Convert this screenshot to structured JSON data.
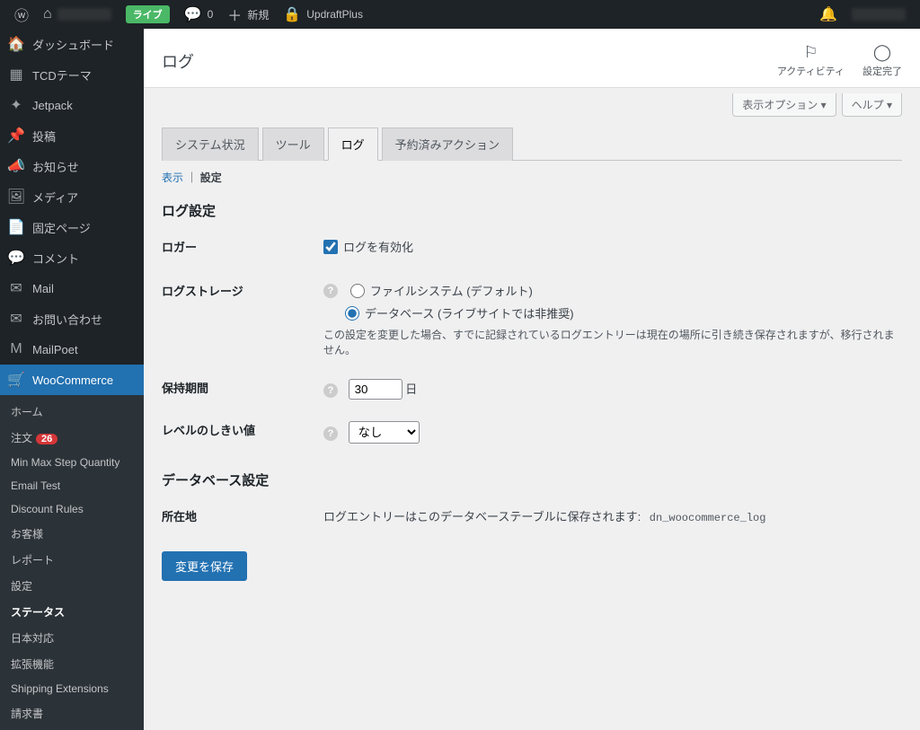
{
  "adminbar": {
    "live": "ライブ",
    "comments": "0",
    "add_new": "新規",
    "updraft": "UpdraftPlus"
  },
  "sidebar": {
    "items": [
      {
        "icon": "🏠",
        "label": "ダッシュボード"
      },
      {
        "icon": "▦",
        "label": "TCDテーマ"
      },
      {
        "icon": "✦",
        "label": "Jetpack"
      },
      {
        "icon": "📌",
        "label": "投稿"
      },
      {
        "icon": "📣",
        "label": "お知らせ"
      },
      {
        "icon": "🖼",
        "label": "メディア"
      },
      {
        "icon": "📄",
        "label": "固定ページ"
      },
      {
        "icon": "💬",
        "label": "コメント"
      },
      {
        "icon": "✉",
        "label": "Mail"
      },
      {
        "icon": "✉",
        "label": "お問い合わせ"
      },
      {
        "icon": "M",
        "label": "MailPoet"
      }
    ],
    "woocommerce": "WooCommerce",
    "submenu": [
      {
        "label": "ホーム"
      },
      {
        "label": "注文",
        "badge": "26"
      },
      {
        "label": "Min Max Step Quantity"
      },
      {
        "label": "Email Test"
      },
      {
        "label": "Discount Rules"
      },
      {
        "label": "お客様"
      },
      {
        "label": "レポート"
      },
      {
        "label": "設定"
      },
      {
        "label": "ステータス",
        "current": true
      },
      {
        "label": "日本対応"
      },
      {
        "label": "拡張機能"
      },
      {
        "label": "Shipping Extensions"
      },
      {
        "label": "請求書"
      }
    ]
  },
  "header": {
    "title": "ログ",
    "activity": "アクティビティ",
    "finish": "設定完了",
    "screen_options": "表示オプション ▾",
    "help": "ヘルプ ▾"
  },
  "tabs": [
    {
      "label": "システム状況"
    },
    {
      "label": "ツール"
    },
    {
      "label": "ログ",
      "active": true
    },
    {
      "label": "予約済みアクション"
    }
  ],
  "subnav": {
    "view": "表示",
    "settings": "設定",
    "sep": "｜"
  },
  "sections": {
    "log_settings": "ログ設定",
    "db_settings": "データベース設定"
  },
  "fields": {
    "logger": {
      "label": "ロガー",
      "checkbox": "ログを有効化",
      "checked": true
    },
    "storage": {
      "label": "ログストレージ",
      "opt1": "ファイルシステム (デフォルト)",
      "opt2": "データベース (ライブサイトでは非推奨)",
      "desc": "この設定を変更した場合、すでに記録されているログエントリーは現在の場所に引き続き保存されますが、移行されません。"
    },
    "retention": {
      "label": "保持期間",
      "value": "30",
      "unit": "日"
    },
    "threshold": {
      "label": "レベルのしきい値",
      "value": "なし"
    },
    "location": {
      "label": "所在地",
      "desc": "ログエントリーはこのデータベーステーブルに保存されます: ",
      "table": "dn_woocommerce_log"
    }
  },
  "save": "変更を保存"
}
